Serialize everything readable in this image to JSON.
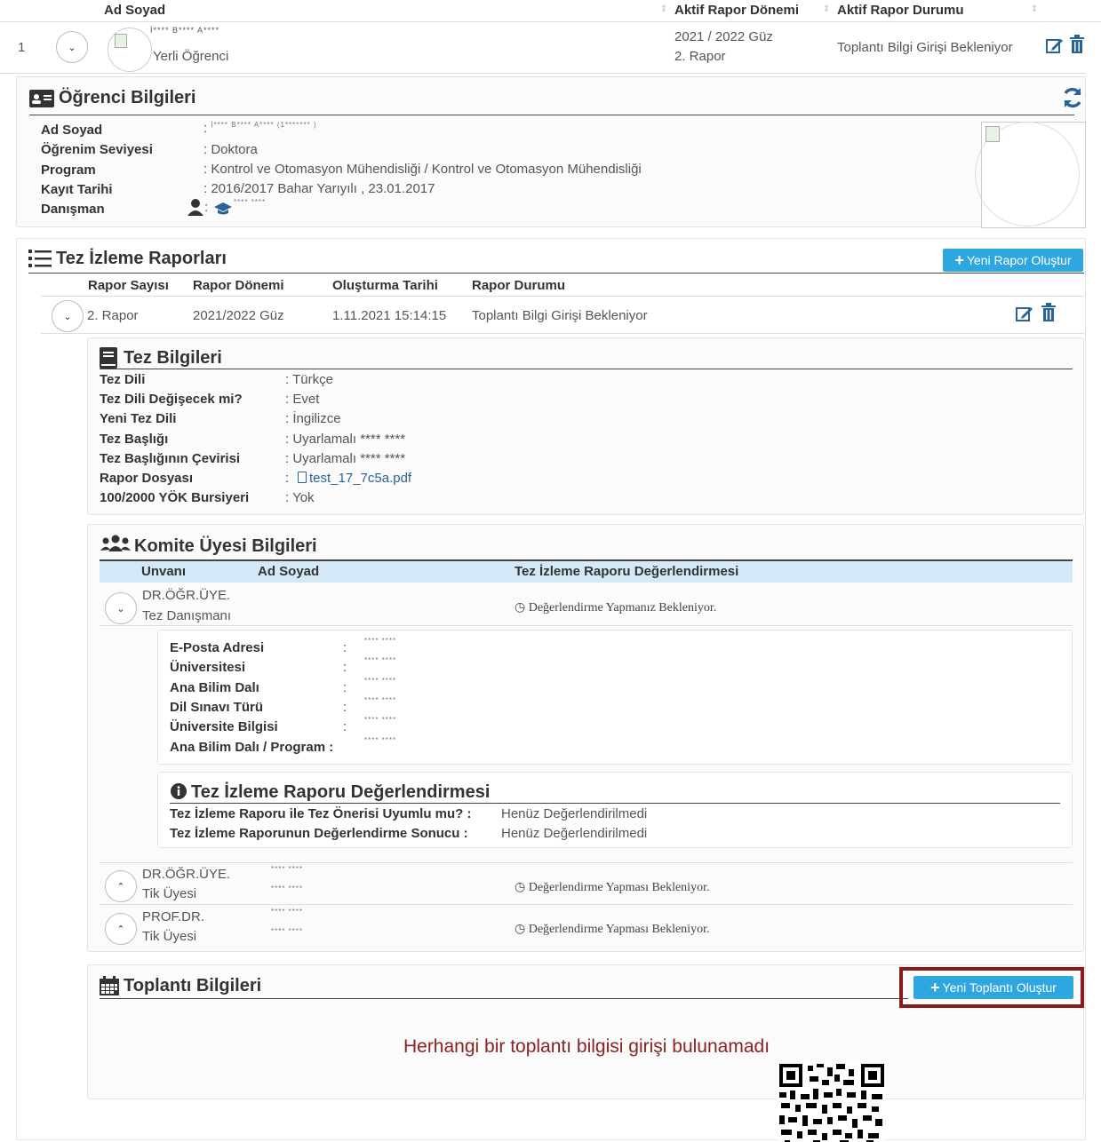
{
  "top_table": {
    "headers": {
      "ad_soyad": "Ad Soyad",
      "rapor_donemi": "Aktif Rapor Dönemi",
      "rapor_durumu": "Aktif Rapor Durumu"
    },
    "row": {
      "index": "1",
      "name_mask": "İ****   B****  A****",
      "type": "Yerli Öğrenci",
      "donem": "2021 / 2022 Güz",
      "rapor": "2. Rapor",
      "durum": "Toplantı Bilgi Girişi Bekleniyor"
    }
  },
  "ogrenci": {
    "title": "Öğrenci Bilgileri",
    "rows": [
      {
        "label": "Ad Soyad",
        "value": "İ****   B****  A****        (1*******    )"
      },
      {
        "label": "Öğrenim Seviyesi",
        "value": "Doktora"
      },
      {
        "label": "Program",
        "value": "Kontrol ve Otomasyon Mühendisliği / Kontrol ve Otomasyon Mühendisliği"
      },
      {
        "label": "Kayıt Tarihi",
        "value": "2016/2017 Bahar Yarıyılı , 23.01.2017"
      },
      {
        "label": "Danışman",
        "value": "**** ****"
      }
    ]
  },
  "tez_izleme": {
    "title": "Tez İzleme Raporları",
    "new_button": "Yeni Rapor Oluştur",
    "headers": [
      "Rapor Sayısı",
      "Rapor Dönemi",
      "Oluşturma Tarihi",
      "Rapor Durumu"
    ],
    "row": {
      "sayi": "2. Rapor",
      "donem": "2021/2022 Güz",
      "tarih": "1.11.2021 15:14:15",
      "durum": "Toplantı Bilgi Girişi Bekleniyor"
    }
  },
  "tez_bilgileri": {
    "title": "Tez Bilgileri",
    "rows": [
      {
        "label": "Tez Dili",
        "value": "Türkçe"
      },
      {
        "label": "Tez Dili Değişecek mi?",
        "value": "Evet"
      },
      {
        "label": "Yeni Tez Dili",
        "value": "İngilizce"
      },
      {
        "label": "Tez Başlığı",
        "value": "Uyarlamalı **** ****"
      },
      {
        "label": "Tez Başlığının Çevirisi",
        "value": "Uyarlamalı **** ****"
      },
      {
        "label": "Rapor Dosyası",
        "value": "test_17_7c5a.pdf"
      },
      {
        "label": "100/2000 YÖK Bursiyeri",
        "value": "Yok"
      }
    ]
  },
  "komite": {
    "title": "Komite Üyesi Bilgileri",
    "headers": {
      "unvan": "Unvanı",
      "ad": "Ad Soyad",
      "degerlendirme": "Tez İzleme Raporu Değerlendirmesi"
    },
    "members": [
      {
        "unvan": "DR.ÖĞR.ÜYE.",
        "rol": "Tez Danışmanı",
        "ad1": "",
        "ad2": "",
        "status": "Değerlendirme Yapmanız Bekleniyor."
      },
      {
        "unvan": "DR.ÖĞR.ÜYE.",
        "rol": "Tik Üyesi",
        "ad1": "**** ****",
        "ad2": "**** ****",
        "status": "Değerlendirme Yapması Bekleniyor."
      },
      {
        "unvan": "PROF.DR.",
        "rol": "Tik Üyesi",
        "ad1": "**** ****",
        "ad2": "**** ****",
        "status": "Değerlendirme Yapması Bekleniyor."
      }
    ],
    "detail": [
      {
        "label": "E-Posta Adresi",
        "sep": ":",
        "value": "**** ****"
      },
      {
        "label": "Üniversitesi",
        "sep": ":",
        "value": "**** ****"
      },
      {
        "label": "Ana Bilim Dalı",
        "sep": ":",
        "value": "**** ****"
      },
      {
        "label": "Dil Sınavı Türü",
        "sep": ":",
        "value": "**** ****"
      },
      {
        "label": "Üniversite Bilgisi",
        "sep": ":",
        "value": "**** ****"
      },
      {
        "label": "Ana Bilim Dalı / Program :",
        "sep": "",
        "value": "**** ****"
      }
    ],
    "eval": {
      "title": "Tez İzleme Raporu Değerlendirmesi",
      "rows": [
        {
          "label": "Tez İzleme Raporu ile Tez Önerisi Uyumlu mu? :",
          "value": "Henüz Değerlendirilmedi"
        },
        {
          "label": "Tez İzleme Raporunun Değerlendirme Sonucu  :",
          "value": "Henüz Değerlendirilmedi"
        }
      ]
    }
  },
  "toplanti": {
    "title": "Toplantı Bilgileri",
    "new_button": "Yeni Toplantı Oluştur",
    "empty": "Herhangi bir toplantı bilgisi girişi bulunamadı",
    "highlight_color": "#8b1a1a"
  },
  "colors": {
    "accent": "#2ea7e0",
    "link": "#2a6496",
    "header_row": "#d4e9f7",
    "empty_text": "#8b2222"
  }
}
